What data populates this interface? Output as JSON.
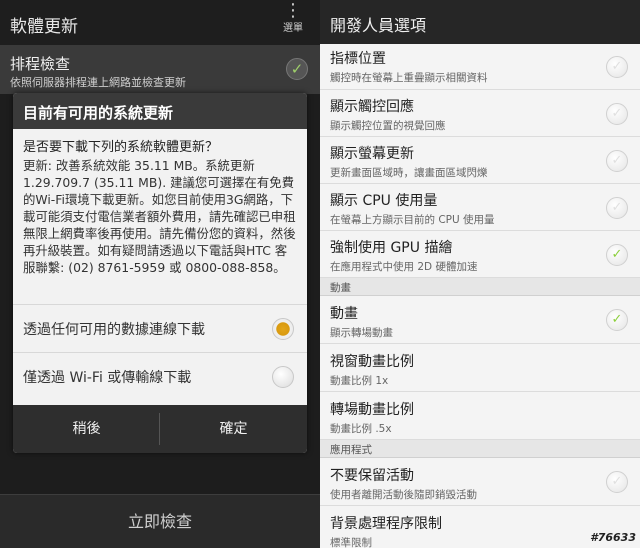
{
  "left": {
    "actionbar": {
      "title": "軟體更新",
      "menu_label": "選單",
      "menu_icon": "overflow-dots-icon"
    },
    "schedule_row": {
      "title": "排程檢查",
      "subtitle": "依照伺服器排程連上網路並檢查更新",
      "checked": true
    },
    "dialog": {
      "title": "目前有可用的系統更新",
      "question": "是否要下載下列的系統軟體更新？",
      "body": "更新: 改善系統效能 35.11 MB。系統更新1.29.709.7 (35.11 MB). 建議您可選擇在有免費的Wi-Fi環境下載更新。如您目前使用3G網路，下載可能須支付電信業者額外費用，請先確認已申租無限上網費率後再使用。請先備份您的資料，然後再升級裝置。如有疑問請透過以下電話與HTC 客服聯繫: (02) 8761-5959 或 0800-088-858。",
      "options": [
        {
          "label": "透過任何可用的數據連線下載",
          "selected": true
        },
        {
          "label": "僅透過 Wi-Fi 或傳輸線下載",
          "selected": false
        }
      ],
      "later_label": "稍後",
      "ok_label": "確定"
    },
    "bottom_button": "立即檢查"
  },
  "right": {
    "actionbar": {
      "title": "開發人員選項"
    },
    "rows_top": [
      {
        "title": "指標位置",
        "subtitle": "觸控時在螢幕上重疊顯示相關資料",
        "checked": false
      },
      {
        "title": "顯示觸控回應",
        "subtitle": "顯示觸控位置的視覺回應",
        "checked": false
      },
      {
        "title": "顯示螢幕更新",
        "subtitle": "更新畫面區域時，讓畫面區域閃爍",
        "checked": false
      },
      {
        "title": "顯示 CPU 使用量",
        "subtitle": "在螢幕上方顯示目前的 CPU 使用量",
        "checked": false
      },
      {
        "title": "強制使用 GPU 描繪",
        "subtitle": "在應用程式中使用 2D 硬體加速",
        "checked": true
      }
    ],
    "section_animation": "動畫",
    "rows_animation": [
      {
        "title": "動畫",
        "subtitle": "顯示轉場動畫",
        "checked": true
      },
      {
        "title": "視窗動畫比例",
        "subtitle": "動畫比例 1x"
      },
      {
        "title": "轉場動畫比例",
        "subtitle": "動畫比例 .5x"
      }
    ],
    "section_apps": "應用程式",
    "rows_apps": [
      {
        "title": "不要保留活動",
        "subtitle": "使用者離開活動後隨即銷毀活動",
        "checked": false
      },
      {
        "title": "背景處理程序限制",
        "subtitle": "標準限制"
      }
    ]
  },
  "watermark": "#76633",
  "colors": {
    "accent_orange": "#d99a10",
    "check_green": "#8ccf3c",
    "dark_bar": "#262626"
  }
}
